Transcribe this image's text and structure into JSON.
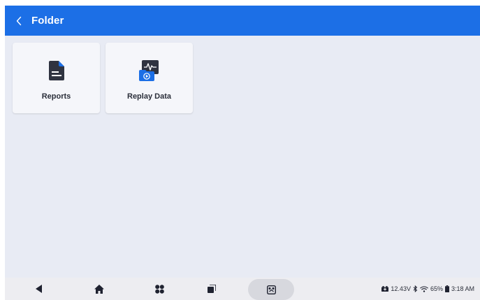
{
  "header": {
    "title": "Folder",
    "back_icon": "chevron-left-icon"
  },
  "folders": [
    {
      "label": "Reports",
      "icon": "document-icon"
    },
    {
      "label": "Replay Data",
      "icon": "replay-data-icon"
    }
  ],
  "navbar": {
    "back_icon": "triangle-back-icon",
    "home_icon": "home-icon",
    "apps_icon": "apps-grid-icon",
    "recents_icon": "recents-icon",
    "vci_icon": "vci-connector-icon"
  },
  "status_bar": {
    "voltage": "12.43V",
    "battery_percent": "65%",
    "time": "3:18 AM"
  },
  "colors": {
    "accent": "#1c6fe6",
    "background": "#e8ebf4",
    "card": "#f5f6fa"
  }
}
